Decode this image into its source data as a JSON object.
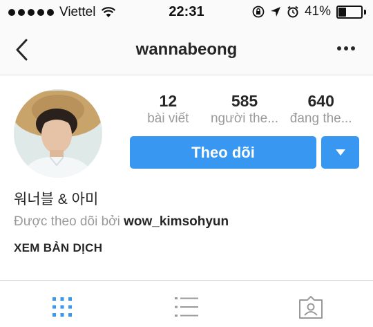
{
  "status_bar": {
    "carrier": "Viettel",
    "time": "22:31",
    "battery_percent": "41%",
    "battery_level": 0.41
  },
  "nav": {
    "title": "wannabeong"
  },
  "profile": {
    "stats": [
      {
        "number": "12",
        "label": "bài viết"
      },
      {
        "number": "585",
        "label": "người the..."
      },
      {
        "number": "640",
        "label": "đang the..."
      }
    ],
    "follow_label": "Theo dõi",
    "bio_name": "워너블 & 아미",
    "followed_by_prefix": "Được theo dõi bởi",
    "followed_by_user": "wow_kimsohyun",
    "translate_label": "XEM BẢN DỊCH"
  },
  "tabs": [
    {
      "icon": "grid-icon",
      "active": true
    },
    {
      "icon": "list-icon",
      "active": false
    },
    {
      "icon": "tagged-icon",
      "active": false
    }
  ],
  "colors": {
    "accent": "#3897f0",
    "active_tab": "#3897f0",
    "inactive_tab": "#999999"
  }
}
